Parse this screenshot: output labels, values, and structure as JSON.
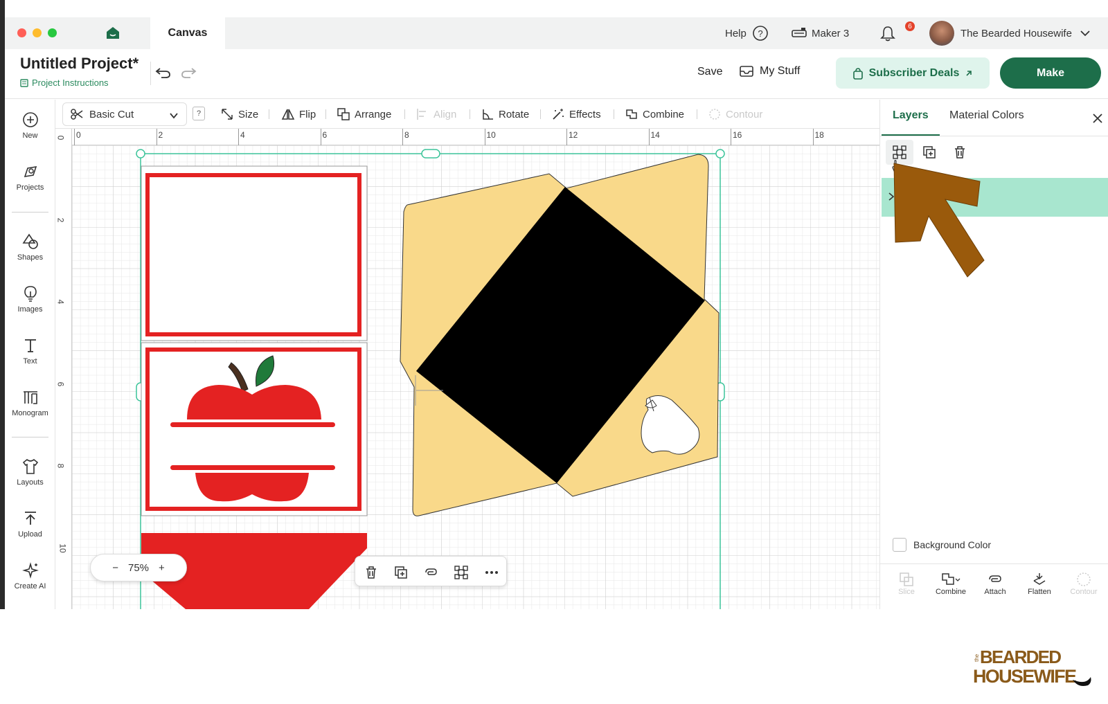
{
  "titlebar": {
    "tab_label": "Canvas",
    "help": "Help",
    "machine": "Maker 3",
    "notification_count": "6",
    "user_name": "The Bearded Housewife"
  },
  "project": {
    "title": "Untitled Project*",
    "instructions_link": "Project Instructions",
    "save": "Save",
    "my_stuff": "My Stuff",
    "subscriber_deals": "Subscriber Deals",
    "make": "Make"
  },
  "sidebar": {
    "items": [
      {
        "label": "New",
        "icon": "plus-circle-icon"
      },
      {
        "label": "Projects",
        "icon": "projects-icon"
      },
      {
        "label": "Shapes",
        "icon": "shapes-icon"
      },
      {
        "label": "Images",
        "icon": "lightbulb-icon"
      },
      {
        "label": "Text",
        "icon": "text-icon"
      },
      {
        "label": "Monogram",
        "icon": "monogram-icon"
      },
      {
        "label": "Layouts",
        "icon": "shirt-icon"
      },
      {
        "label": "Upload",
        "icon": "upload-icon"
      },
      {
        "label": "Create AI",
        "icon": "sparkle-icon"
      }
    ]
  },
  "toolbar": {
    "operation": "Basic Cut",
    "help_badge": "?",
    "size": "Size",
    "flip": "Flip",
    "arrange": "Arrange",
    "align": "Align",
    "rotate": "Rotate",
    "effects": "Effects",
    "combine": "Combine",
    "contour": "Contour"
  },
  "canvas": {
    "ruler_top": [
      "0",
      "2",
      "4",
      "6",
      "8",
      "10",
      "12",
      "14",
      "16",
      "18"
    ],
    "ruler_left": [
      "0",
      "2",
      "4",
      "6",
      "8",
      "10"
    ],
    "zoom_level": "75%",
    "zoom_minus": "−",
    "zoom_plus": "+",
    "colors": {
      "red": "#e42222",
      "envelope": "#f9d98a",
      "black": "#000000",
      "apple_leaf": "#1f7a3a",
      "apple_stem": "#4a3020",
      "selection": "#3cc49a"
    }
  },
  "panel": {
    "tab_layers": "Layers",
    "tab_material_colors": "Material Colors",
    "background_color": "Background Color",
    "bottom_actions": [
      "Slice",
      "Combine",
      "Attach",
      "Flatten",
      "Contour"
    ],
    "highlight_arrow_color": "#9a5a0c"
  },
  "watermark": {
    "line1": "BEARDED",
    "line2": "HOUSEWIFE",
    "small": "the"
  }
}
